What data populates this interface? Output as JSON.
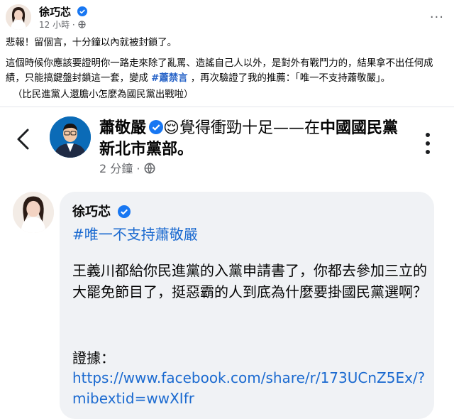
{
  "post": {
    "author": "徐巧芯",
    "time": "12 小時",
    "meta_separator": "·",
    "para1": "悲報！留個言，十分鐘以內就被封鎖了。",
    "para2_before": "這個時候你應該要證明你一路走來除了亂罵、造謠自己人以外，是對外有戰鬥力的，結果拿不出任何成績，只能搞鍵盤封鎖這一套，變成 ",
    "para2_hashtag": "#蕭禁言",
    "para2_after": " ，再次驗證了我的推薦：「唯一不支持蕭敬嚴」。",
    "para3": "（比民進黨人還膽小怎麼為國民黨出戰啦）",
    "more_label": "···"
  },
  "screenshot": {
    "page_name": "蕭敬嚴",
    "emoji": "😌",
    "activity": "覺得衝勁十足——在",
    "place": "中國國民黨新北市黨部",
    "place_suffix": "。",
    "time": "2 分鐘",
    "time_separator": "·",
    "comment": {
      "author": "徐巧芯",
      "hashtag": "#唯一不支持蕭敬嚴",
      "body": "王義川都給你民進黨的入黨申請書了，你都去參加三立的大罷免節目了，挺惡霸的人到底為什麼要掛國民黨選啊？",
      "evidence_label": "證據：",
      "link": "https://www.facebook.com/share/r/173UCnZ5Ex/?mibextid=wwXIfr"
    }
  },
  "colors": {
    "accent": "#1b6ad0",
    "verified": "#1877f2",
    "muted": "#65676b",
    "bubble": "#f0f2f5"
  }
}
